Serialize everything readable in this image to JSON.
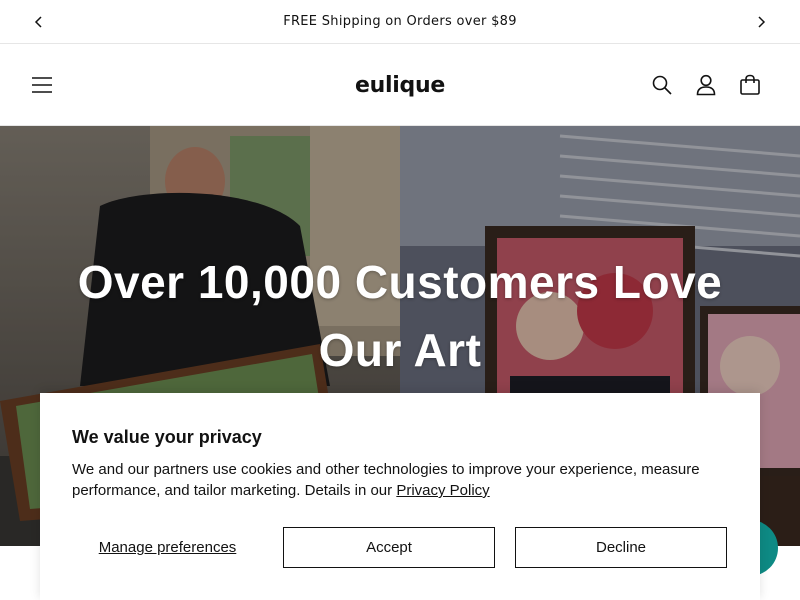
{
  "announcement": {
    "text": "FREE Shipping on Orders over $89",
    "prev_icon": "chevron-left-icon",
    "next_icon": "chevron-right-icon"
  },
  "header": {
    "logo_text": "eulique",
    "menu_icon": "hamburger-menu-icon",
    "icons": [
      "search-icon",
      "account-icon",
      "cart-icon"
    ]
  },
  "hero": {
    "title": "Over 10,000 Customers Love Our Art"
  },
  "cookie_banner": {
    "title": "We value your privacy",
    "body": "We and our partners use cookies and other technologies to improve your experience, measure performance, and tailor marketing. Details in our",
    "link_text": "Privacy Policy",
    "manage_label": "Manage preferences",
    "accept_label": "Accept",
    "decline_label": "Decline"
  },
  "chat": {
    "icon": "chat-bubble-icon",
    "color": "#0e8a84"
  }
}
